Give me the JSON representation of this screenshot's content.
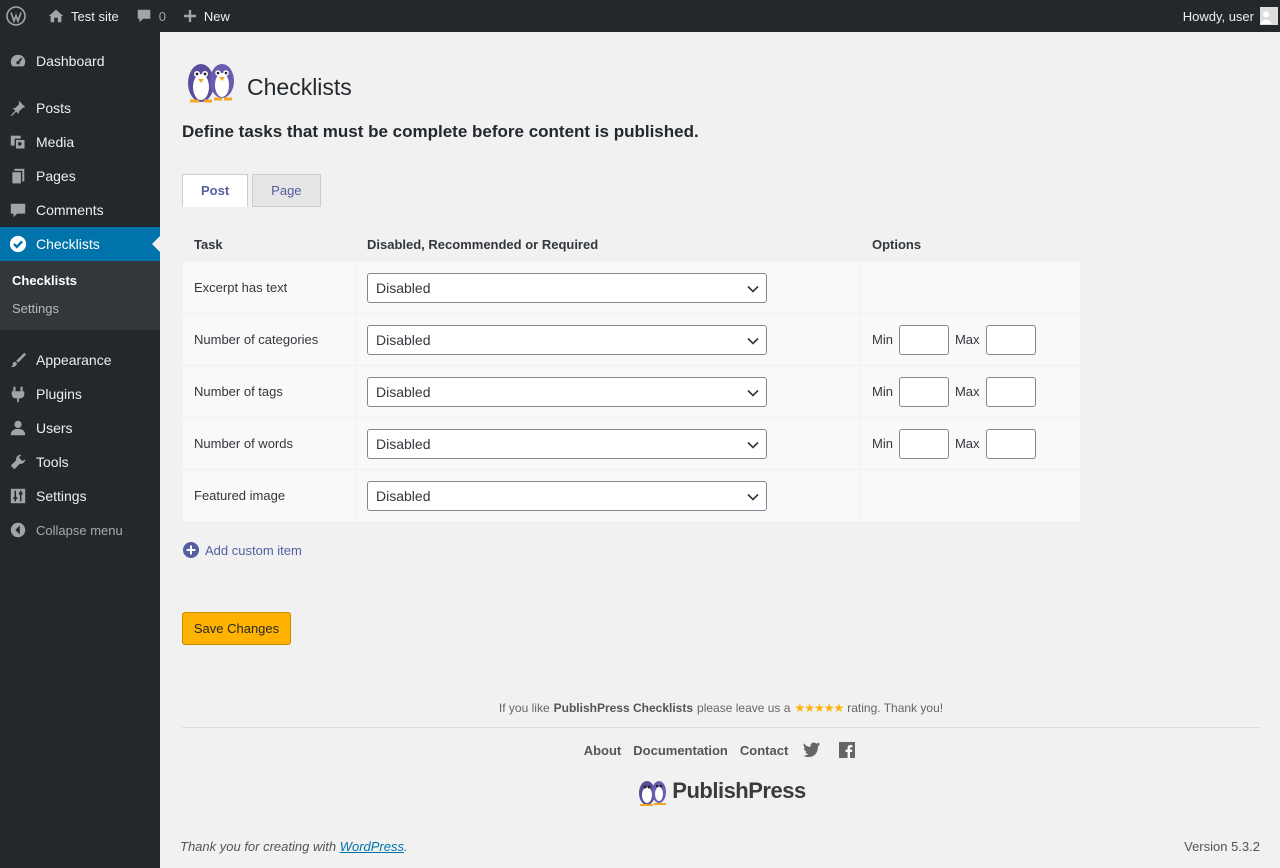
{
  "adminbar": {
    "site_name": "Test site",
    "comments_count": "0",
    "new_label": "New",
    "howdy": "Howdy, user"
  },
  "sidebar": {
    "items": [
      {
        "label": "Dashboard",
        "icon": "dashboard-icon"
      },
      {
        "label": "Posts",
        "icon": "pin-icon"
      },
      {
        "label": "Media",
        "icon": "media-icon"
      },
      {
        "label": "Pages",
        "icon": "pages-icon"
      },
      {
        "label": "Comments",
        "icon": "comment-icon"
      },
      {
        "label": "Checklists",
        "icon": "check-icon",
        "current": true
      },
      {
        "label": "Appearance",
        "icon": "brush-icon"
      },
      {
        "label": "Plugins",
        "icon": "plugin-icon"
      },
      {
        "label": "Users",
        "icon": "user-icon"
      },
      {
        "label": "Tools",
        "icon": "wrench-icon"
      },
      {
        "label": "Settings",
        "icon": "sliders-icon"
      }
    ],
    "submenu": [
      "Checklists",
      "Settings"
    ],
    "collapse_label": "Collapse menu"
  },
  "page": {
    "title": "Checklists",
    "subtitle": "Define tasks that must be complete before content is published.",
    "tabs": [
      "Post",
      "Page"
    ],
    "table": {
      "headers": [
        "Task",
        "Disabled, Recommended or Required",
        "Options"
      ],
      "rows": [
        {
          "task": "Excerpt has text",
          "status": "Disabled",
          "has_minmax": false
        },
        {
          "task": "Number of categories",
          "status": "Disabled",
          "has_minmax": true
        },
        {
          "task": "Number of tags",
          "status": "Disabled",
          "has_minmax": true
        },
        {
          "task": "Number of words",
          "status": "Disabled",
          "has_minmax": true
        },
        {
          "task": "Featured image",
          "status": "Disabled",
          "has_minmax": false
        }
      ],
      "min_label": "Min",
      "max_label": "Max"
    },
    "add_custom_label": "Add custom item",
    "save_label": "Save Changes"
  },
  "plugin_footer": {
    "rating_prefix": "If you like",
    "rating_product": "PublishPress Checklists",
    "rating_middle": "please leave us a",
    "stars": "★★★★★",
    "rating_suffix": "rating. Thank you!",
    "links": [
      "About",
      "Documentation",
      "Contact"
    ],
    "brand": "PublishPress"
  },
  "wpfooter": {
    "thanks_prefix": "Thank you for creating with",
    "thanks_link": "WordPress",
    "thanks_suffix": ".",
    "version": "Version 5.3.2"
  },
  "colors": {
    "accent": "#0073aa",
    "save_button": "#ffb300",
    "tab_link": "#555e9f"
  }
}
